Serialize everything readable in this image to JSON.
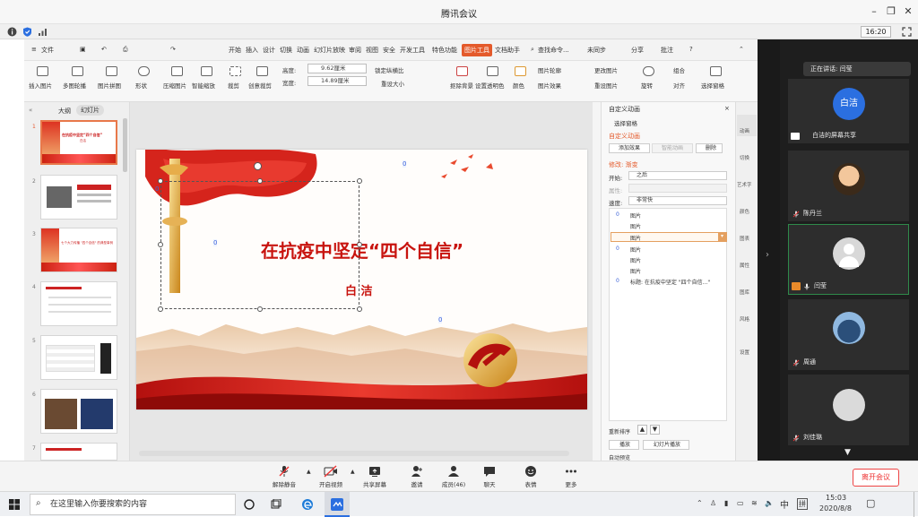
{
  "window": {
    "title": "腾讯会议"
  },
  "clock": "16:20",
  "wps": {
    "menu_file": "文件",
    "menus": [
      "开始",
      "插入",
      "设计",
      "切换",
      "动画",
      "幻灯片放映",
      "审阅",
      "视图",
      "安全",
      "开发工具",
      "特色功能",
      "图片工具",
      "文档助手"
    ],
    "active_menu": "图片工具",
    "search_cmd": "查找命令...",
    "sync_status": "未同步",
    "share": "分享",
    "annotate": "批注",
    "ribbon": {
      "insert_pic": "插入图片",
      "multi_crop": "多图轮播",
      "pic_collage": "图片拼图",
      "shape": "形状",
      "compress": "压缩图片",
      "smart_scale": "智能缩放",
      "crop": "裁剪",
      "creative_crop": "创意裁剪",
      "height_label": "高度:",
      "height_value": "9.62厘米",
      "width_label": "宽度:",
      "width_value": "14.89厘米",
      "lock_ratio": "锁定纵横比",
      "reset_size": "重设大小",
      "remove_bg": "抠除背景",
      "set_transparent": "设置透明色",
      "color": "颜色",
      "pic_outline": "图片轮廓",
      "pic_effect": "图片效果",
      "change_pic": "更改图片",
      "reset_pic": "重设图片",
      "rotate": "旋转",
      "group": "组合",
      "align": "对齐",
      "selection_pane": "选择窗格"
    },
    "panel_tabs": {
      "outline": "大纲",
      "slides": "幻灯片"
    },
    "slide_numbers": [
      "1",
      "2",
      "3",
      "4",
      "5",
      "6",
      "7"
    ],
    "thumbs": {
      "t1_title": "在抗疫中坚定“四个自信”",
      "t1_sub": "白洁",
      "t3_title": "七个大力传播 \"四个自信\" 的典型事例"
    },
    "slide": {
      "title": "在抗疫中坚定“四个自信”",
      "author": "白 洁",
      "anim_markers": [
        "0",
        "0",
        "0",
        "0"
      ]
    },
    "anim_panel": {
      "header": "自定义动画",
      "select_pane": "选择窗格",
      "section": "自定义动画",
      "add_effect": "添加效果",
      "smart_anim": "智能动画",
      "delete": "删除",
      "modify": "修改: 渐变",
      "start_label": "开始:",
      "start_value": "之后",
      "prop_label": "属性:",
      "speed_label": "速度:",
      "speed_value": "非常快",
      "items": [
        {
          "n": "0",
          "label": "图片"
        },
        {
          "n": "",
          "label": "图片"
        },
        {
          "n": "",
          "label": "图片"
        },
        {
          "n": "0",
          "label": "图片"
        },
        {
          "n": "",
          "label": "图片"
        },
        {
          "n": "",
          "label": "图片"
        },
        {
          "n": "0",
          "label": "标题: 在抗疫中坚定 \"四个自信...\""
        }
      ],
      "reorder": "重新排序",
      "play": "播放",
      "slideshow": "幻灯片播放",
      "auto_preview": "自动预览"
    },
    "sidebar": [
      "动画",
      "切换",
      "艺术字",
      "颜色",
      "图表",
      "属性",
      "图库",
      "风格",
      "设置"
    ]
  },
  "meeting": {
    "speaking": "正在讲话: 闫莹",
    "participants": [
      {
        "name": "白洁的屏幕共享",
        "avatar_text": "白洁"
      },
      {
        "name": "陈丹兰",
        "avatar_text": ""
      },
      {
        "name": "闫莹",
        "avatar_text": ""
      },
      {
        "name": "周通",
        "avatar_text": ""
      },
      {
        "name": "刘佳璐",
        "avatar_text": ""
      }
    ],
    "toolbar": {
      "unmute": "解除静音",
      "video": "开启视频",
      "share": "共享屏幕",
      "invite": "邀请",
      "members": "成员(46)",
      "chat": "聊天",
      "reactions": "表情",
      "more": "更多",
      "leave": "离开会议"
    }
  },
  "taskbar": {
    "search_placeholder": "在这里输入你要搜索的内容",
    "time": "15:03",
    "date": "2020/8/8",
    "ime": "中",
    "layout": "拼"
  },
  "colors": {
    "accent_red": "#d9261c",
    "meeting_bg": "#1e1e1e",
    "selected_tile": "#2f8a4a"
  }
}
